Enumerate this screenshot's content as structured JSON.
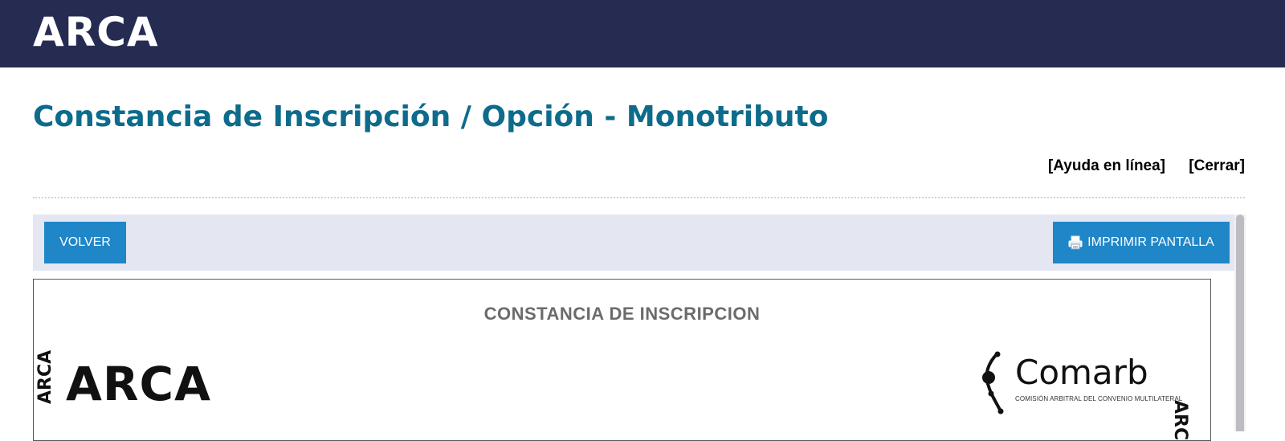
{
  "header": {
    "logo_text": "ARCA",
    "background_color": "#262b51"
  },
  "page": {
    "title": "Constancia de Inscripción / Opción - Monotributo",
    "title_color": "#0d6b8c"
  },
  "links": {
    "help": "[Ayuda en línea]",
    "close": "[Cerrar]"
  },
  "toolbar": {
    "back_label": "VOLVER",
    "print_label": "IMPRIMIR PANTALLA",
    "print_icon": "printer-icon",
    "button_color": "#1f86c8"
  },
  "document": {
    "title": "CONSTANCIA DE INSCRIPCION",
    "logo_text": "ARCA",
    "side_text_left": "ARCA",
    "side_text_right": "ARCA",
    "comarb_name": "Comarb",
    "comarb_subtitle": "COMISIÓN ARBITRAL DEL CONVENIO MULTILATERAL"
  }
}
